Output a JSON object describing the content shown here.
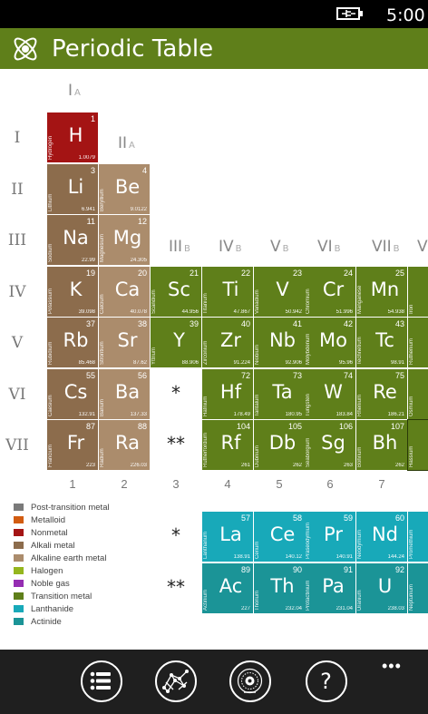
{
  "status": {
    "time": "5:00",
    "battery_icon": "battery-charging-icon"
  },
  "app": {
    "title": "Periodic Table",
    "logo_icon": "atom-icon"
  },
  "group_labels": [
    {
      "roman": "I",
      "sub": "A"
    },
    {
      "roman": "II",
      "sub": "A"
    },
    {
      "roman": "III",
      "sub": "B"
    },
    {
      "roman": "IV",
      "sub": "B"
    },
    {
      "roman": "V",
      "sub": "B"
    },
    {
      "roman": "VI",
      "sub": "B"
    },
    {
      "roman": "VII",
      "sub": "B"
    },
    {
      "roman": "V",
      "sub": ""
    }
  ],
  "period_labels": [
    "I",
    "II",
    "III",
    "IV",
    "V",
    "VI",
    "VII"
  ],
  "column_numbers": [
    "1",
    "2",
    "3",
    "4",
    "5",
    "6",
    "7"
  ],
  "stars": {
    "single": "*",
    "double": "**"
  },
  "colors": {
    "nonmetal": "#a41414",
    "alkali": "#8c6c4c",
    "alkaline": "#ab8c6c",
    "transition": "#5f7f1a",
    "lanthanide": "#18a9b9",
    "actinide": "#1b9497"
  },
  "elements": [
    {
      "sym": "H",
      "num": "1",
      "name": "Hydrogen",
      "mass": "1.0079",
      "cat": "nonmetal"
    },
    {
      "sym": "Li",
      "num": "3",
      "name": "Lithium",
      "mass": "6.941",
      "cat": "alkali"
    },
    {
      "sym": "Be",
      "num": "4",
      "name": "Beryllium",
      "mass": "9.0122",
      "cat": "alkaline"
    },
    {
      "sym": "Na",
      "num": "11",
      "name": "Sodium",
      "mass": "22.99",
      "cat": "alkali"
    },
    {
      "sym": "Mg",
      "num": "12",
      "name": "Magnesium",
      "mass": "24.305",
      "cat": "alkaline"
    },
    {
      "sym": "K",
      "num": "19",
      "name": "Potassium",
      "mass": "39.098",
      "cat": "alkali"
    },
    {
      "sym": "Ca",
      "num": "20",
      "name": "Calcium",
      "mass": "40.078",
      "cat": "alkaline"
    },
    {
      "sym": "Sc",
      "num": "21",
      "name": "Scandium",
      "mass": "44.956",
      "cat": "transition"
    },
    {
      "sym": "Ti",
      "num": "22",
      "name": "Titanium",
      "mass": "47.867",
      "cat": "transition"
    },
    {
      "sym": "V",
      "num": "23",
      "name": "Vanadium",
      "mass": "50.942",
      "cat": "transition"
    },
    {
      "sym": "Cr",
      "num": "24",
      "name": "Chromium",
      "mass": "51.996",
      "cat": "transition"
    },
    {
      "sym": "Mn",
      "num": "25",
      "name": "Manganese",
      "mass": "54.938",
      "cat": "transition"
    },
    {
      "sym": "",
      "num": "",
      "name": "Iron",
      "mass": "",
      "cat": "transition"
    },
    {
      "sym": "Rb",
      "num": "37",
      "name": "Rubidium",
      "mass": "85.468",
      "cat": "alkali"
    },
    {
      "sym": "Sr",
      "num": "38",
      "name": "Strontium",
      "mass": "87.62",
      "cat": "alkaline"
    },
    {
      "sym": "Y",
      "num": "39",
      "name": "Yttrium",
      "mass": "88.906",
      "cat": "transition"
    },
    {
      "sym": "Zr",
      "num": "40",
      "name": "Zirconium",
      "mass": "91.224",
      "cat": "transition"
    },
    {
      "sym": "Nb",
      "num": "41",
      "name": "Niobium",
      "mass": "92.906",
      "cat": "transition"
    },
    {
      "sym": "Mo",
      "num": "42",
      "name": "Molybdenum",
      "mass": "95.96",
      "cat": "transition"
    },
    {
      "sym": "Tc",
      "num": "43",
      "name": "Technetium",
      "mass": "98.91",
      "cat": "transition"
    },
    {
      "sym": "",
      "num": "",
      "name": "Ruthenium",
      "mass": "",
      "cat": "transition"
    },
    {
      "sym": "Cs",
      "num": "55",
      "name": "Caesium",
      "mass": "132.91",
      "cat": "alkali"
    },
    {
      "sym": "Ba",
      "num": "56",
      "name": "Barium",
      "mass": "137.33",
      "cat": "alkaline"
    },
    {
      "sym": "Hf",
      "num": "72",
      "name": "Hafnium",
      "mass": "178.49",
      "cat": "transition"
    },
    {
      "sym": "Ta",
      "num": "73",
      "name": "Tantalum",
      "mass": "180.95",
      "cat": "transition"
    },
    {
      "sym": "W",
      "num": "74",
      "name": "Tungsten",
      "mass": "183.84",
      "cat": "transition"
    },
    {
      "sym": "Re",
      "num": "75",
      "name": "Rhenium",
      "mass": "186.21",
      "cat": "transition"
    },
    {
      "sym": "",
      "num": "",
      "name": "Osmium",
      "mass": "",
      "cat": "transition"
    },
    {
      "sym": "Fr",
      "num": "87",
      "name": "Francium",
      "mass": "223",
      "cat": "alkali"
    },
    {
      "sym": "Ra",
      "num": "88",
      "name": "Radium",
      "mass": "226.03",
      "cat": "alkaline"
    },
    {
      "sym": "Rf",
      "num": "104",
      "name": "Rutherfordium",
      "mass": "261",
      "cat": "transition"
    },
    {
      "sym": "Db",
      "num": "105",
      "name": "Dubnium",
      "mass": "262",
      "cat": "transition"
    },
    {
      "sym": "Sg",
      "num": "106",
      "name": "Seaborgium",
      "mass": "263",
      "cat": "transition"
    },
    {
      "sym": "Bh",
      "num": "107",
      "name": "Bohrium",
      "mass": "262",
      "cat": "transition"
    },
    {
      "sym": "",
      "num": "",
      "name": "Hassium",
      "mass": "",
      "cat": "transition"
    },
    {
      "sym": "La",
      "num": "57",
      "name": "Lanthanum",
      "mass": "138.91",
      "cat": "lanthanide"
    },
    {
      "sym": "Ce",
      "num": "58",
      "name": "Cerium",
      "mass": "140.12",
      "cat": "lanthanide"
    },
    {
      "sym": "Pr",
      "num": "59",
      "name": "Praseodymium",
      "mass": "140.91",
      "cat": "lanthanide"
    },
    {
      "sym": "Nd",
      "num": "60",
      "name": "Neodymium",
      "mass": "144.24",
      "cat": "lanthanide"
    },
    {
      "sym": "",
      "num": "",
      "name": "Promethium",
      "mass": "",
      "cat": "lanthanide"
    },
    {
      "sym": "Ac",
      "num": "89",
      "name": "Actinium",
      "mass": "227",
      "cat": "actinide"
    },
    {
      "sym": "Th",
      "num": "90",
      "name": "Thorium",
      "mass": "232.04",
      "cat": "actinide"
    },
    {
      "sym": "Pa",
      "num": "91",
      "name": "Protactinium",
      "mass": "231.04",
      "cat": "actinide"
    },
    {
      "sym": "U",
      "num": "92",
      "name": "Uranium",
      "mass": "238.03",
      "cat": "actinide"
    },
    {
      "sym": "",
      "num": "",
      "name": "Neptunium",
      "mass": "",
      "cat": "actinide"
    }
  ],
  "legend": [
    {
      "label": "Post-transition metal",
      "color": "#7a7a7a"
    },
    {
      "label": "Metalloid",
      "color": "#d25c11"
    },
    {
      "label": "Nonmetal",
      "color": "#a41414"
    },
    {
      "label": "Alkali metal",
      "color": "#8c6c4c"
    },
    {
      "label": "Alkaline earth metal",
      "color": "#ab8c6c"
    },
    {
      "label": "Halogen",
      "color": "#95b61e"
    },
    {
      "label": "Noble gas",
      "color": "#952db2"
    },
    {
      "label": "Transition metal",
      "color": "#5f7f1a"
    },
    {
      "label": "Lanthanide",
      "color": "#18a9b9"
    },
    {
      "label": "Actinide",
      "color": "#1b9497"
    }
  ],
  "bottom_bar": {
    "buttons": [
      {
        "name": "list-icon"
      },
      {
        "name": "molecule-structure-icon"
      },
      {
        "name": "atom-detail-icon"
      },
      {
        "name": "help-icon",
        "glyph": "?"
      }
    ],
    "more": "•••"
  }
}
